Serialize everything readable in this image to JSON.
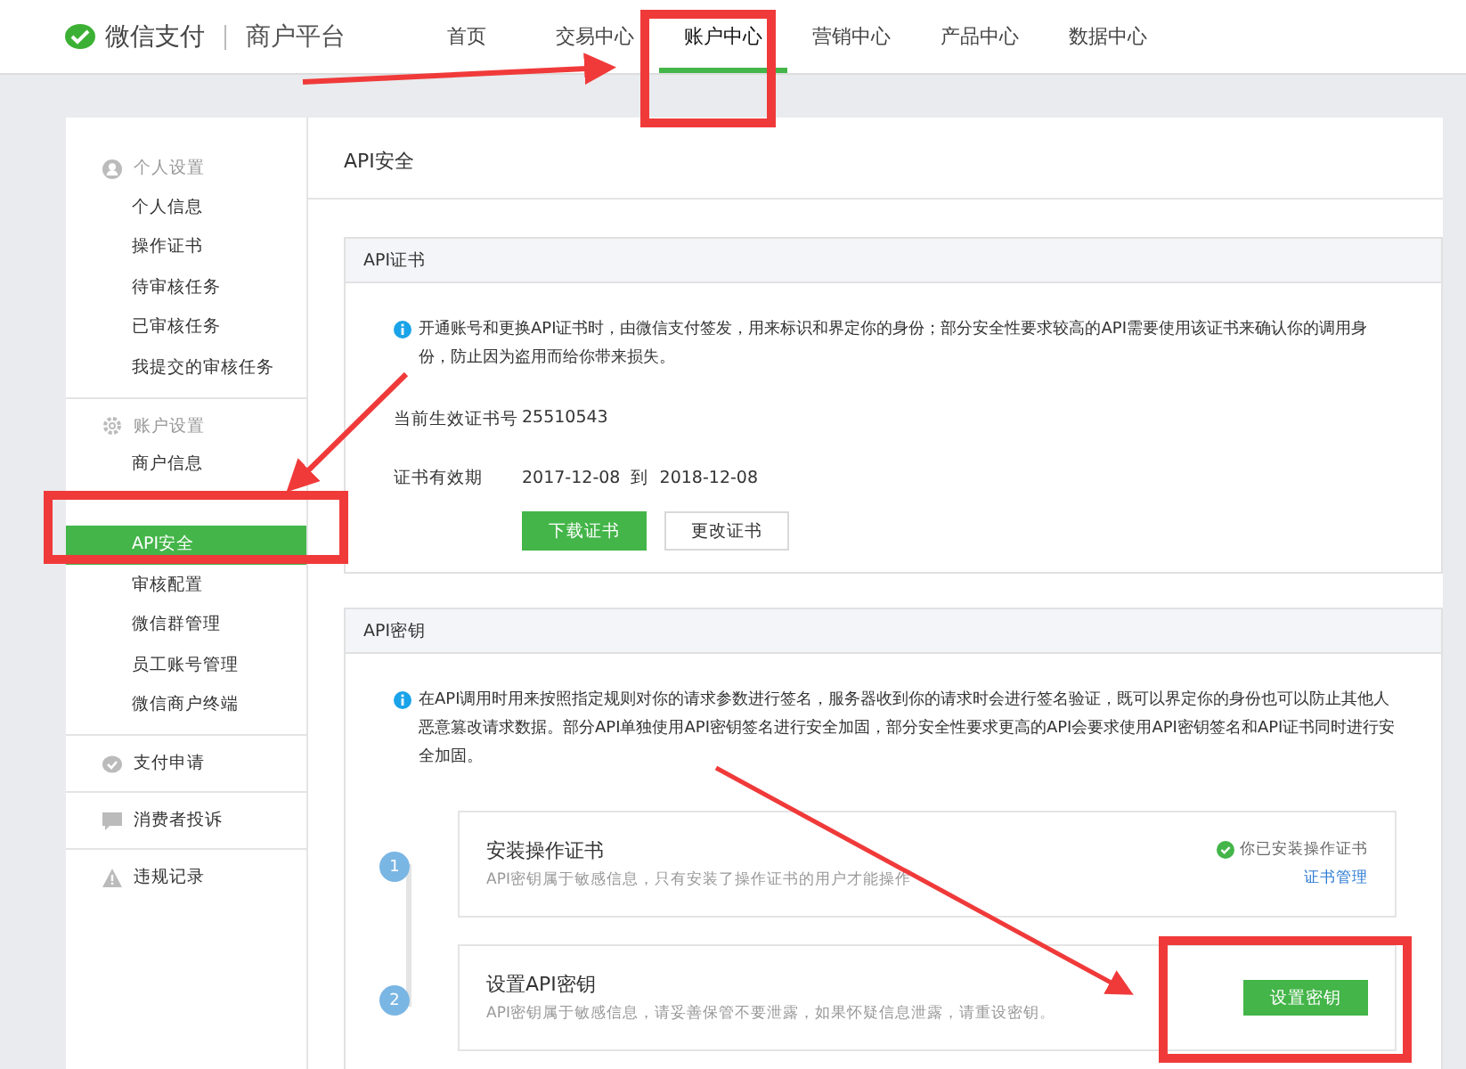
{
  "header": {
    "logo_text": "微信支付",
    "product": "商户平台"
  },
  "nav": [
    {
      "label": "首页",
      "selected": false
    },
    {
      "label": "交易中心",
      "selected": false
    },
    {
      "label": "账户中心",
      "selected": true
    },
    {
      "label": "营销中心",
      "selected": false
    },
    {
      "label": "产品中心",
      "selected": false
    },
    {
      "label": "数据中心",
      "selected": false
    }
  ],
  "sidebar": {
    "groups": [
      {
        "kind": "person",
        "label": "个人设置",
        "children": [
          {
            "label": "个人信息",
            "selected": false
          },
          {
            "label": "操作证书",
            "selected": false
          },
          {
            "label": "待审核任务",
            "selected": false
          },
          {
            "label": "已审核任务",
            "selected": false
          },
          {
            "label": "我提交的审核任务",
            "selected": false
          }
        ]
      },
      {
        "kind": "gear",
        "label": "账户设置",
        "children": [
          {
            "label": "商户信息",
            "selected": false
          },
          {
            "label": "API安全",
            "selected": true
          },
          {
            "label": "审核配置",
            "selected": false
          },
          {
            "label": "微信群管理",
            "selected": false
          },
          {
            "label": "员工账号管理",
            "selected": false
          },
          {
            "label": "微信商户终端",
            "selected": false
          }
        ]
      },
      {
        "kind": "pay",
        "label": "支付申请"
      },
      {
        "kind": "chat",
        "label": "消费者投诉"
      },
      {
        "kind": "warning",
        "label": "违规记录"
      }
    ]
  },
  "page_title": "API安全",
  "cert_card": {
    "title": "API证书",
    "notice": "开通账号和更换API证书时，由微信支付签发，用来标识和界定你的身份；部分安全性要求较高的API需要使用该证书来确认你的调用身份，防止因为盗用而给你带来损失。",
    "fields": [
      {
        "label": "当前生效证书号",
        "value": "25510543"
      },
      {
        "label": "证书有效期",
        "value": "2017-12-08  到  2018-12-08"
      }
    ],
    "buttons": [
      {
        "label": "下载证书",
        "kind": "primary"
      },
      {
        "label": "更改证书",
        "kind": "default"
      }
    ]
  },
  "key_card": {
    "title": "API密钥",
    "notice": "在API调用时用来按照指定规则对你的请求参数进行签名，服务器收到你的请求时会进行签名验证，既可以界定你的身份也可以防止其他人恶意篡改请求数据。部分API单独使用API密钥签名进行安全加固，部分安全性要求更高的API会要求使用API密钥签名和API证书同时进行安全加固。",
    "steps": [
      {
        "number": "1",
        "title": "安装操作证书",
        "desc": "API密钥属于敏感信息，只有安装了操作证书的用户才能操作",
        "status": "你已安装操作证书",
        "link": "证书管理"
      },
      {
        "number": "2",
        "title": "设置API密钥",
        "desc": "API密钥属于敏感信息，请妥善保管不要泄露，如果怀疑信息泄露，请重设密钥。",
        "button": "设置密钥"
      }
    ]
  }
}
